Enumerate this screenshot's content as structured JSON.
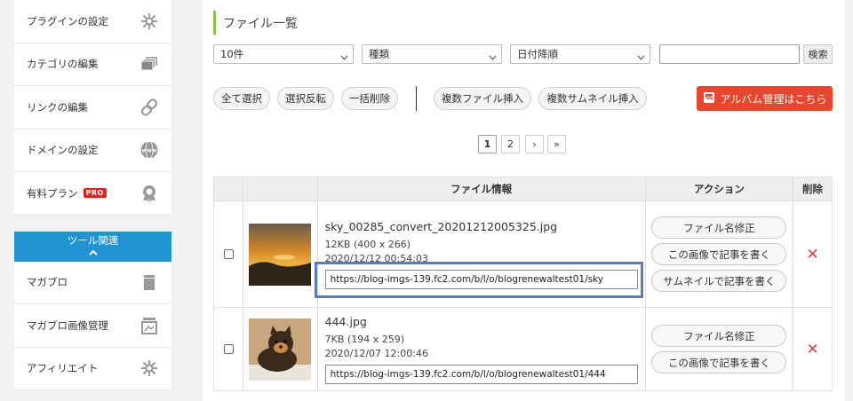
{
  "sidebar": {
    "items": [
      {
        "label": "プラグインの設定",
        "icon": "gear-icon"
      },
      {
        "label": "カテゴリの編集",
        "icon": "folders-icon"
      },
      {
        "label": "リンクの編集",
        "icon": "link-icon"
      },
      {
        "label": "ドメインの設定",
        "icon": "www-icon"
      },
      {
        "label": "有料プラン",
        "badge": "PRO",
        "icon": "award-icon"
      }
    ],
    "tools_header": "ツール関連",
    "tools": [
      {
        "label": "マガブロ",
        "icon": "trash-icon"
      },
      {
        "label": "マガブロ画像管理",
        "icon": "image-manage-icon"
      },
      {
        "label": "アフィリエイト",
        "icon": "gear-icon"
      }
    ]
  },
  "main": {
    "title": "ファイル一覧",
    "filters": {
      "count": "10件",
      "type": "種類",
      "sort": "日付降順",
      "search_value": "",
      "search_button": "検索"
    },
    "actions": [
      "全て選択",
      "選択反転",
      "一括削除",
      "複数ファイル挿入",
      "複数サムネイル挿入"
    ],
    "album_button": "アルバム管理はこちら",
    "pagination": [
      "1",
      "2",
      "›",
      "»"
    ],
    "table": {
      "headers": [
        "",
        "",
        "ファイル情報",
        "アクション",
        "削除"
      ],
      "rows": [
        {
          "filename": "sky_00285_convert_20201212005325.jpg",
          "size": "12KB (400 x 266)",
          "date": "2020/12/12 00:54:03",
          "url": "https://blog-imgs-139.fc2.com/b/l/o/blogrenewaltest01/sky",
          "actions": [
            "ファイル名修正",
            "この画像で記事を書く",
            "サムネイルで記事を書く"
          ],
          "delete": "✕"
        },
        {
          "filename": "444.jpg",
          "size": "7KB (194 x 259)",
          "date": "2020/12/07 12:00:46",
          "url": "https://blog-imgs-139.fc2.com/b/l/o/blogrenewaltest01/444",
          "actions": [
            "ファイル名修正",
            "この画像で記事を書く"
          ],
          "delete": "✕"
        }
      ]
    }
  },
  "colors": {
    "accent_blue": "#2193d3",
    "album_red": "#e8472d",
    "delete_red": "#e53935",
    "highlight": "#5b7dbb",
    "title_bar": "#8bc34a"
  }
}
